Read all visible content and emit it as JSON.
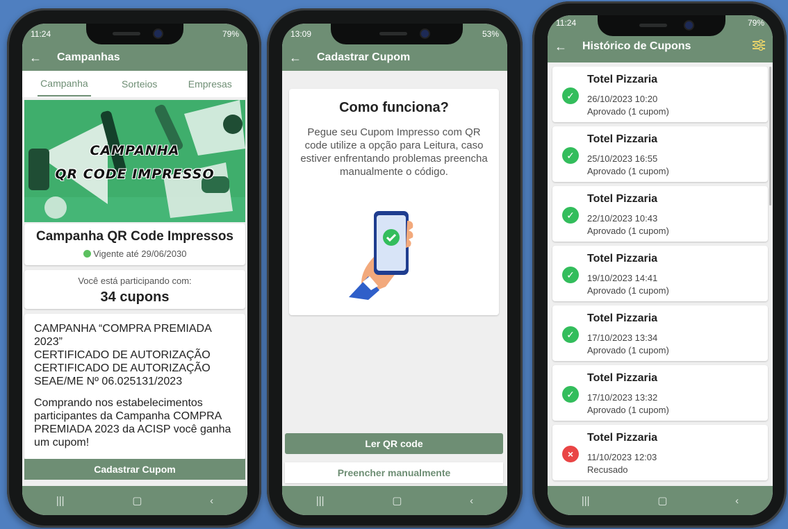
{
  "phone1": {
    "status": {
      "time": "11:24",
      "battery": "79%"
    },
    "appbar_title": "Campanhas",
    "tabs": [
      "Campanha",
      "Sorteios",
      "Empresas"
    ],
    "banner": {
      "line1": "CAMPANHA",
      "line2": "QR CODE IMPRESSO"
    },
    "campaign_title": "Campanha QR Code Impressos",
    "validity": "Vigente até 29/06/2030",
    "participating_label": "Você está participando com:",
    "coupons_count": "34 cupons",
    "description": [
      "CAMPANHA  “COMPRA PREMIADA 2023”",
      "CERTIFICADO DE AUTORIZAÇÃO",
      "CERTIFICADO DE AUTORIZAÇÃO",
      "SEAE/ME Nº 06.025131/2023"
    ],
    "description2": "Comprando nos estabelecimentos participantes da Campanha COMPRA PREMIADA 2023 da ACISP você ganha um cupom!",
    "button": "Cadastrar Cupom"
  },
  "phone2": {
    "status": {
      "time": "13:09",
      "battery": "53%"
    },
    "appbar_title": "Cadastrar Cupom",
    "how_title": "Como funciona?",
    "how_text": "Pegue seu Cupom Impresso com QR code utilize a opção para Leitura, caso estiver enfrentando problemas preencha manualmente o código.",
    "btn_read": "Ler QR code",
    "btn_manual": "Preencher manualmente"
  },
  "phone3": {
    "status": {
      "time": "11:24",
      "battery": "79%"
    },
    "appbar_title": "Histórico de Cupons",
    "items": [
      {
        "name": "Totel Pizzaria",
        "date": "26/10/2023 10:20",
        "status": "Aprovado (1 cupom)"
      },
      {
        "name": "Totel Pizzaria",
        "date": "25/10/2023 16:55",
        "status": "Aprovado (1 cupom)"
      },
      {
        "name": "Totel Pizzaria",
        "date": "22/10/2023 10:43",
        "status": "Aprovado (1 cupom)"
      },
      {
        "name": "Totel Pizzaria",
        "date": "19/10/2023 14:41",
        "status": "Aprovado (1 cupom)"
      },
      {
        "name": "Totel Pizzaria",
        "date": "17/10/2023 13:34",
        "status": "Aprovado (1 cupom)"
      },
      {
        "name": "Totel Pizzaria",
        "date": "17/10/2023 13:32",
        "status": "Aprovado (1 cupom)"
      },
      {
        "name": "Totel Pizzaria",
        "date": "11/10/2023 12:03",
        "status": "Recusado"
      }
    ]
  },
  "icons": {
    "approved": "check-circle-icon",
    "rejected": "x-circle-icon",
    "filter": "sliders-icon"
  },
  "colors": {
    "primary": "#6e8e74",
    "success": "#33bd5c",
    "danger": "#e94545",
    "background": "#4f7fc0"
  }
}
